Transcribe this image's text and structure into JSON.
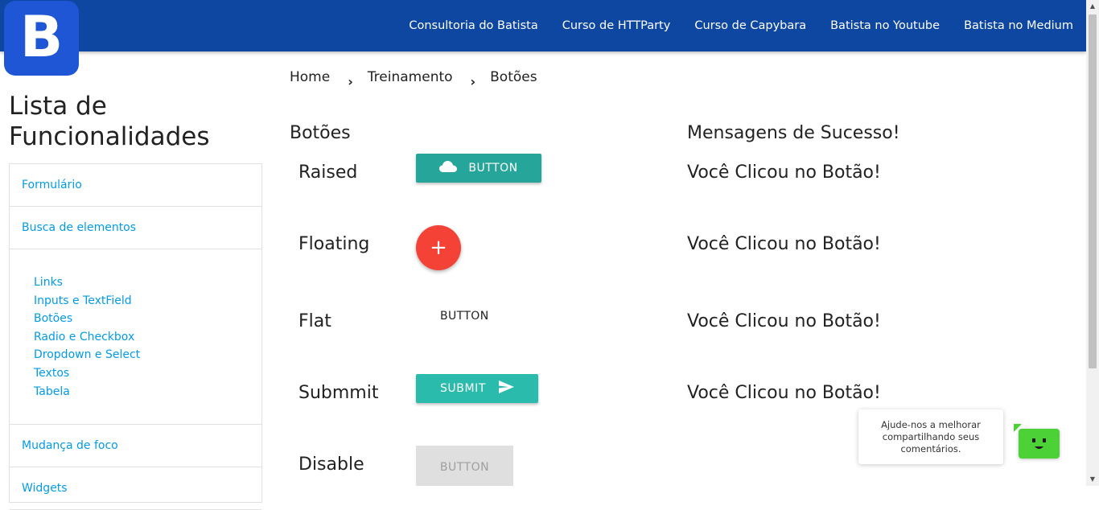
{
  "header": {
    "logo_letter": "B",
    "nav": [
      "Consultoria do Batista",
      "Curso de HTTParty",
      "Curso de Capybara",
      "Batista no Youtube",
      "Batista no Medium"
    ]
  },
  "sidebar": {
    "title": "Lista de Funcionalidades",
    "items": {
      "formulario": "Formulário",
      "busca": "Busca de elementos",
      "sub": [
        "Links",
        "Inputs e TextField",
        "Botões",
        "Radio e Checkbox",
        "Dropdown e Select",
        "Textos",
        "Tabela"
      ],
      "mudanca": "Mudança de foco",
      "next": "Widgets"
    }
  },
  "breadcrumb": [
    "Home",
    "Treinamento",
    "Botões"
  ],
  "main": {
    "heading": "Botões",
    "messages_heading": "Mensagens de Sucesso!",
    "rows": [
      {
        "label": "Raised",
        "message": "Você Clicou no Botão!"
      },
      {
        "label": "Floating",
        "message": "Você Clicou no Botão!"
      },
      {
        "label": "Flat",
        "message": "Você Clicou no Botão!"
      },
      {
        "label": "Submmit",
        "message": "Você Clicou no Botão!"
      },
      {
        "label": "Disable",
        "message": ""
      }
    ],
    "buttons": {
      "raised": "BUTTON",
      "floating": "+",
      "flat": "BUTTON",
      "submit": "SUBMIT",
      "disabled": "BUTTON"
    }
  },
  "feedback": {
    "text": "Ajude-nos a melhorar compartilhando seus comentários."
  },
  "colors": {
    "navbar": "#0d47a1",
    "raised_button": "#26a69a",
    "floating_button": "#f44336",
    "submit_button": "#2bbbad",
    "feedback_widget": "#4cd137",
    "link": "#039be5"
  }
}
